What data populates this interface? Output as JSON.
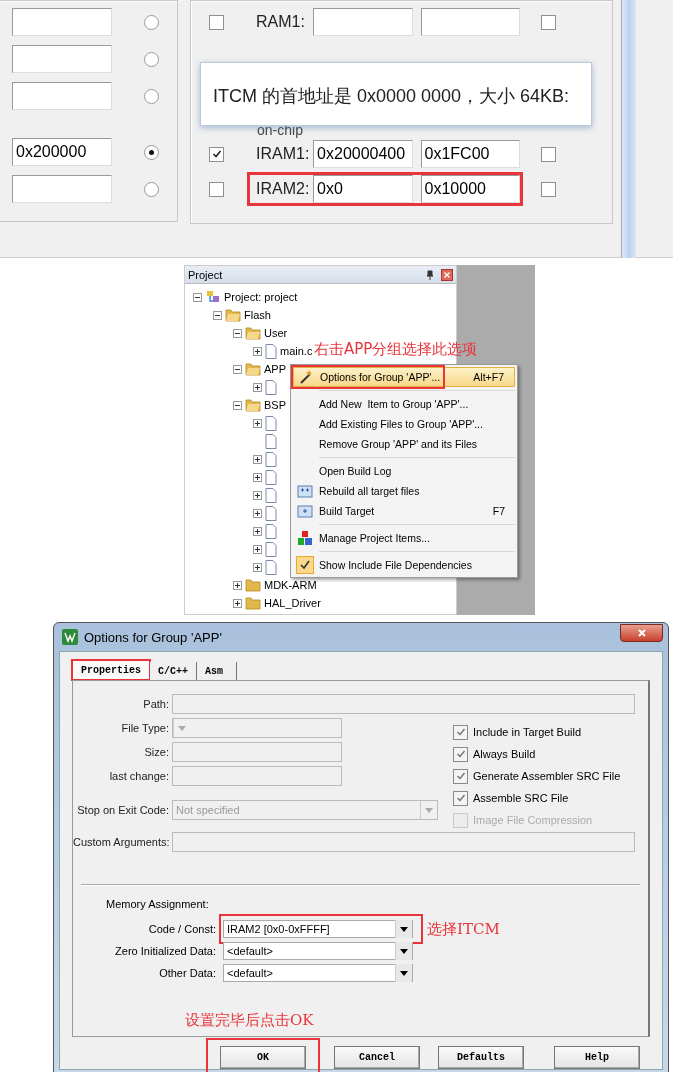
{
  "memory_panel": {
    "left_groups": [
      [
        {
          "selected": false
        },
        {
          "selected": false
        },
        {
          "selected": false
        }
      ],
      [
        {
          "value": "0x200000",
          "selected": true
        },
        {
          "selected": false
        }
      ]
    ],
    "off_chip_rows": [
      {
        "checked": false,
        "label": "RAM1:",
        "noinit": false
      }
    ],
    "subheading": "on-chip",
    "on_chip_rows": [
      {
        "checked": true,
        "label": "IRAM1:",
        "start": "0x20000400",
        "size": "0x1FC00",
        "noinit": false,
        "highlighted": false
      },
      {
        "checked": false,
        "label": "IRAM2:",
        "start": "0x0",
        "size": "0x10000",
        "noinit": false,
        "highlighted": true
      }
    ],
    "tooltip": "ITCM 的首地址是 0x0000 0000，大小 64KB:"
  },
  "project_panel": {
    "title": "Project",
    "tree": [
      {
        "kind": "project",
        "label": "Project: project",
        "expanded": true,
        "children": [
          {
            "kind": "target",
            "label": "Flash",
            "expanded": true,
            "children": [
              {
                "kind": "folder",
                "label": "User",
                "expanded": true,
                "children": [
                  {
                    "kind": "file",
                    "label": "main.c",
                    "expanded": false
                  }
                ]
              },
              {
                "kind": "folder",
                "label": "APP",
                "expanded": true,
                "children": [
                  {
                    "kind": "file",
                    "expanded": false
                  }
                ]
              },
              {
                "kind": "folder",
                "label": "BSP",
                "expanded": true,
                "children": [
                  {
                    "kind": "file",
                    "expanded": false
                  },
                  {
                    "kind": "leaf"
                  },
                  {
                    "kind": "file",
                    "expanded": false
                  },
                  {
                    "kind": "file",
                    "expanded": false
                  },
                  {
                    "kind": "file",
                    "expanded": false
                  },
                  {
                    "kind": "file",
                    "expanded": false
                  },
                  {
                    "kind": "file",
                    "expanded": false
                  },
                  {
                    "kind": "file",
                    "expanded": false
                  },
                  {
                    "kind": "file",
                    "expanded": false
                  }
                ]
              },
              {
                "kind": "folder",
                "label": "MDK-ARM",
                "expanded": false
              },
              {
                "kind": "folder",
                "label": "HAL_Driver",
                "expanded": false
              }
            ]
          }
        ]
      }
    ],
    "annotation": "右击APP分组选择此选项",
    "context_menu": [
      {
        "kind": "options",
        "label": "Options for Group 'APP'...",
        "shortcut": "Alt+F7",
        "selected": true,
        "highlighted": true
      },
      {
        "kind": "separator"
      },
      {
        "kind": "plain",
        "label": "Add New  Item to Group 'APP'...",
        "selected": false
      },
      {
        "kind": "plain",
        "label": "Add Existing Files to Group 'APP'...",
        "selected": false
      },
      {
        "kind": "plain",
        "label": "Remove Group 'APP' and its Files",
        "selected": false
      },
      {
        "kind": "separator"
      },
      {
        "kind": "plain",
        "label": "Open Build Log",
        "selected": false
      },
      {
        "kind": "rebuild",
        "label": "Rebuild all target files",
        "selected": false
      },
      {
        "kind": "build",
        "label": "Build Target",
        "shortcut": "F7",
        "selected": false
      },
      {
        "kind": "separator"
      },
      {
        "kind": "manage",
        "label": "Manage Project Items...",
        "selected": false
      },
      {
        "kind": "separator"
      },
      {
        "kind": "toggle",
        "label": "Show Include File Dependencies",
        "selected": false,
        "checked": true
      }
    ]
  },
  "dialog": {
    "title": "Options for Group 'APP'",
    "tabs": [
      {
        "label": "Properties",
        "selected": true,
        "highlighted": true
      },
      {
        "label": "C/C++",
        "selected": false,
        "highlighted": false
      },
      {
        "label": "Asm",
        "selected": false,
        "highlighted": false
      }
    ],
    "path_label": "Path:",
    "file_type_label": "File Type:",
    "size_label": "Size:",
    "last_change_label": "last change:",
    "exit_code": {
      "label": "Stop on Exit Code:",
      "value": "Not specified"
    },
    "custom_args_label": "Custom Arguments:",
    "options": [
      {
        "label": "Include in Target Build",
        "checked": true,
        "disabled": false
      },
      {
        "label": "Always Build",
        "checked": true,
        "disabled": false
      },
      {
        "label": "Generate Assembler SRC File",
        "checked": true,
        "disabled": false
      },
      {
        "label": "Assemble SRC File",
        "checked": true,
        "disabled": false
      },
      {
        "label": "Image File Compression",
        "checked": false,
        "disabled": true
      }
    ],
    "memory_heading": "Memory Assignment:",
    "memory": [
      {
        "label": "Code / Const:",
        "value": "IRAM2 [0x0-0xFFFF]",
        "highlighted": true
      },
      {
        "label": "Zero Initialized Data:",
        "value": "<default>",
        "highlighted": false
      },
      {
        "label": "Other Data:",
        "value": "<default>",
        "highlighted": false
      }
    ],
    "memory_note": "选择ITCM",
    "ok_note": "设置完毕后点击OK",
    "buttons": [
      {
        "label": "OK",
        "highlighted": true
      },
      {
        "label": "Cancel",
        "highlighted": false
      },
      {
        "label": "Defaults",
        "highlighted": false
      },
      {
        "label": "Help",
        "highlighted": false
      }
    ]
  }
}
